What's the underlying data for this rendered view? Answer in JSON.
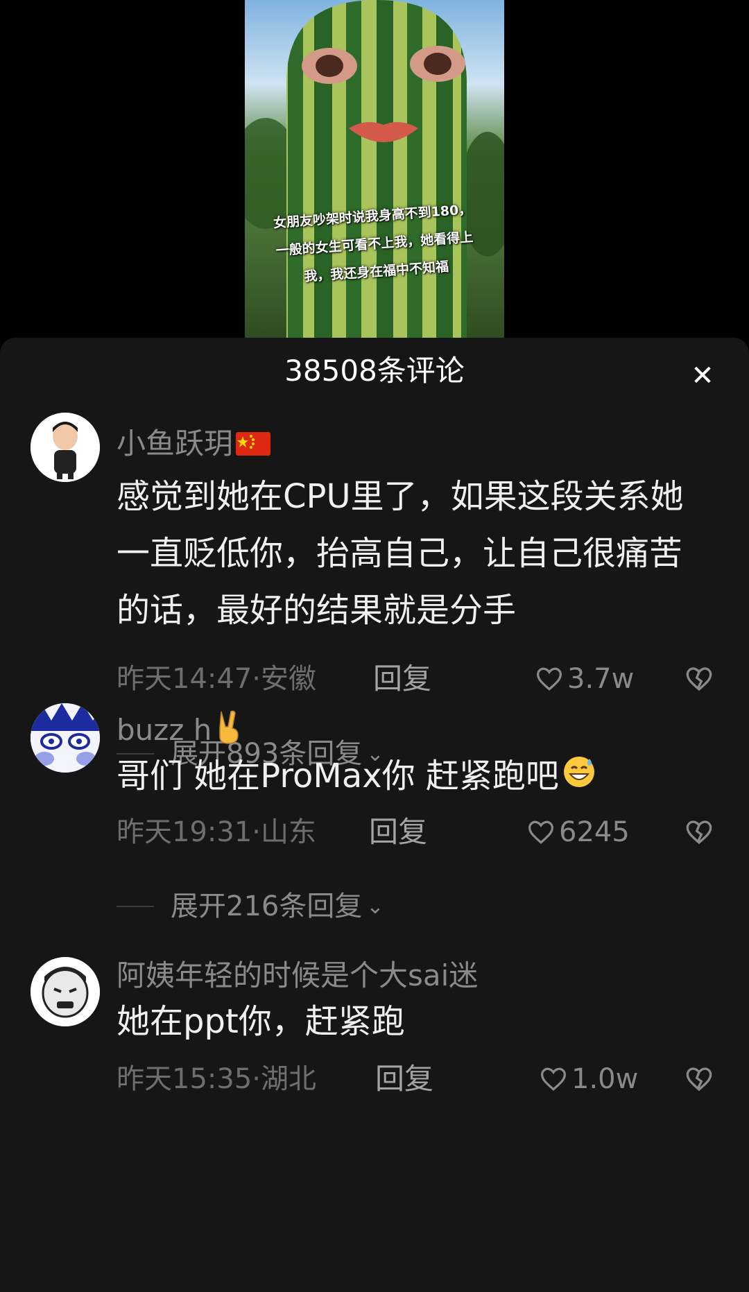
{
  "video": {
    "caption_lines": [
      "女朋友吵架时说我身高不到180，",
      "一般的女生可看不上我，她看得上",
      "我，我还身在福中不知福"
    ]
  },
  "sheet": {
    "title": "38508条评论",
    "close_icon": "close-icon"
  },
  "comments": [
    {
      "username": "小鱼跃玥",
      "badge": "china-flag-emoji",
      "text": "感觉到她在CPU里了，如果这段关系她一直贬低你，抬高自己，让自己很痛苦的话，最好的结果就是分手",
      "time": "昨天14:47·安徽",
      "reply_label": "回复",
      "likes": "3.7w",
      "expand_label": "展开893条回复"
    },
    {
      "username": "buzz h",
      "badge": "victory-hand-emoji",
      "text": "哥们 她在ProMax你 赶紧跑吧",
      "text_emoji": "grinning-sweat-emoji",
      "time": "昨天19:31·山东",
      "reply_label": "回复",
      "likes": "6245",
      "expand_label": "展开216条回复"
    },
    {
      "username": "阿姨年轻的时候是个大sai迷",
      "text": "她在ppt你，赶紧跑",
      "time": "昨天15:35·湖北",
      "reply_label": "回复",
      "likes": "1.0w"
    }
  ],
  "colors": {
    "background": "#161616",
    "text": "#f0f0f0",
    "muted": "#8a8a8a"
  }
}
